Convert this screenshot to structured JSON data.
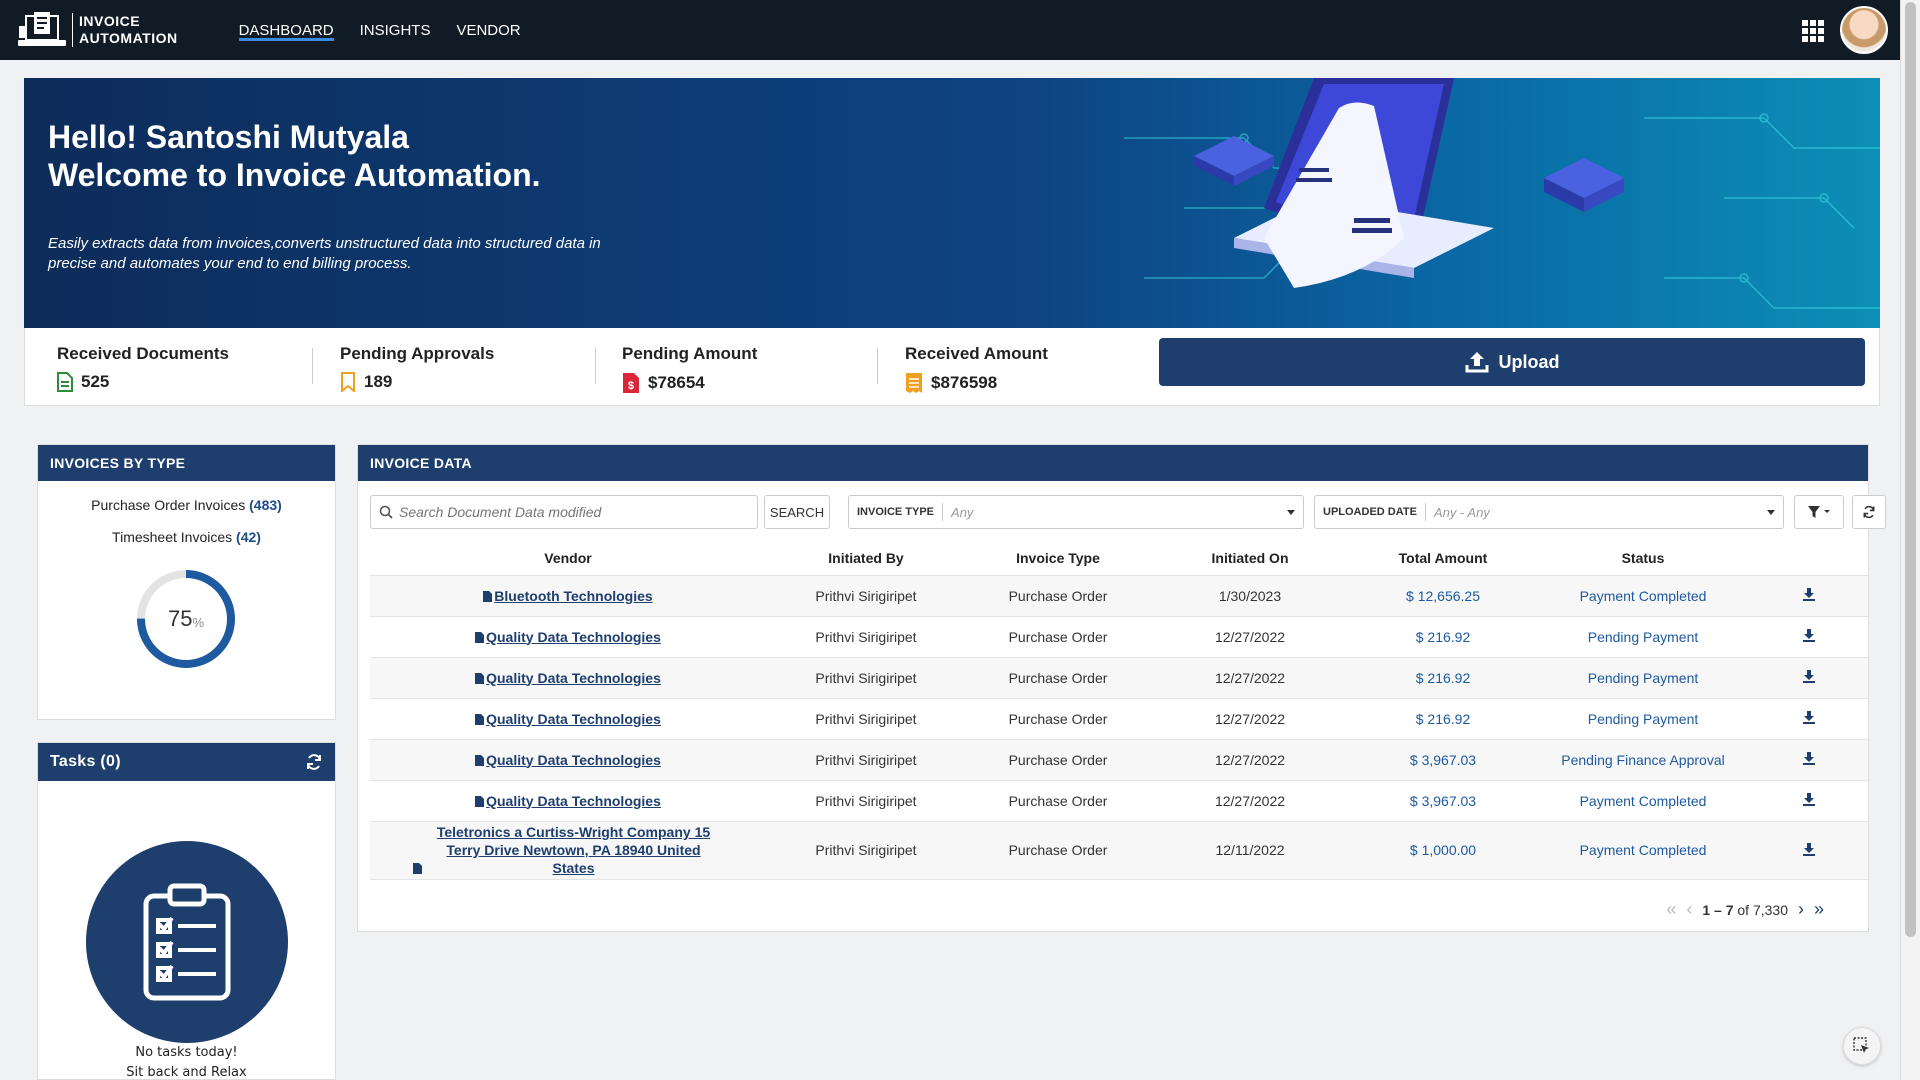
{
  "brand": {
    "line1": "INVOICE",
    "line2": "AUTOMATION"
  },
  "nav": [
    {
      "label": "DASHBOARD",
      "active": true
    },
    {
      "label": "INSIGHTS",
      "active": false
    },
    {
      "label": "VENDOR",
      "active": false
    }
  ],
  "hero": {
    "greeting": "Hello! Santoshi Mutyala",
    "welcome": "Welcome to Invoice Automation.",
    "description": "Easily extracts data from invoices,converts unstructured data into structured data in precise and automates your end to end billing process."
  },
  "kpis": [
    {
      "title": "Received Documents",
      "value": "525",
      "icon": "document-icon",
      "color": "#2e8b3a"
    },
    {
      "title": "Pending Approvals",
      "value": "189",
      "icon": "bookmark-icon",
      "color": "#f0a020"
    },
    {
      "title": "Pending Amount",
      "value": "$78654",
      "icon": "invoice-dollar-icon",
      "color": "#d9263a"
    },
    {
      "title": "Received Amount",
      "value": "$876598",
      "icon": "receipt-icon",
      "color": "#f0a020"
    }
  ],
  "upload": {
    "label": "Upload"
  },
  "invoices_by_type": {
    "title": "INVOICES BY TYPE",
    "items": [
      {
        "label": "Purchase Order Invoices",
        "count": "(483)"
      },
      {
        "label": "Timesheet Invoices",
        "count": "(42)"
      }
    ],
    "percent": "75",
    "percent_sign": "%",
    "percent_value": 75
  },
  "tasks": {
    "title": "Tasks (0)",
    "msg1": "No tasks today!",
    "msg2": "Sit back and Relax"
  },
  "invoice_data": {
    "title": "INVOICE DATA",
    "search_placeholder": "Search Document Data modified",
    "search_button": "SEARCH",
    "invoice_type_label": "INVOICE TYPE",
    "invoice_type_value": "Any",
    "uploaded_date_label": "UPLOADED DATE",
    "uploaded_date_value": "Any - Any",
    "columns": [
      "Vendor",
      "Initiated By",
      "Invoice Type",
      "Initiated On",
      "Total Amount",
      "Status"
    ],
    "rows": [
      {
        "vendor": "Bluetooth Technologies",
        "by": "Prithvi Sirigiripet",
        "type": "Purchase Order",
        "on": "1/30/2023",
        "amount": "$ 12,656.25",
        "status": "Payment Completed"
      },
      {
        "vendor": "Quality Data Technologies",
        "by": "Prithvi Sirigiripet",
        "type": "Purchase Order",
        "on": "12/27/2022",
        "amount": "$ 216.92",
        "status": "Pending Payment"
      },
      {
        "vendor": "Quality Data Technologies",
        "by": "Prithvi Sirigiripet",
        "type": "Purchase Order",
        "on": "12/27/2022",
        "amount": "$ 216.92",
        "status": "Pending Payment"
      },
      {
        "vendor": "Quality Data Technologies",
        "by": "Prithvi Sirigiripet",
        "type": "Purchase Order",
        "on": "12/27/2022",
        "amount": "$ 216.92",
        "status": "Pending Payment"
      },
      {
        "vendor": "Quality Data Technologies",
        "by": "Prithvi Sirigiripet",
        "type": "Purchase Order",
        "on": "12/27/2022",
        "amount": "$ 3,967.03",
        "status": "Pending Finance Approval"
      },
      {
        "vendor": "Quality Data Technologies",
        "by": "Prithvi Sirigiripet",
        "type": "Purchase Order",
        "on": "12/27/2022",
        "amount": "$ 3,967.03",
        "status": "Payment Completed"
      },
      {
        "vendor": "Teletronics a Curtiss-Wright Company 15 Terry Drive Newtown, PA 18940 United States",
        "by": "Prithvi Sirigiripet",
        "type": "Purchase Order",
        "on": "12/11/2022",
        "amount": "$ 1,000.00",
        "status": "Payment Completed"
      }
    ],
    "pager": {
      "range": "1 – 7",
      "of": "of 7,330"
    }
  },
  "colors": {
    "nav_bg": "#111b26",
    "primary": "#1e3e6e",
    "link": "#1e5aa0",
    "accent": "#3b8be0"
  }
}
